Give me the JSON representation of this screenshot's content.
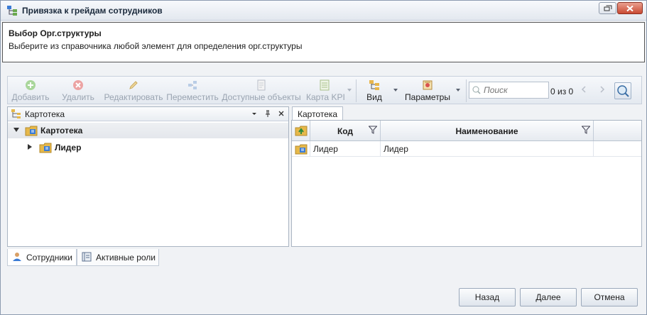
{
  "window": {
    "title": "Привязка к грейдам сотрудников"
  },
  "header": {
    "title": "Выбор Орг.структуры",
    "description": "Выберите из справочника любой элемент для определения орг.структуры"
  },
  "toolbar": {
    "add": "Добавить",
    "delete": "Удалить",
    "edit": "Редактировать",
    "move": "Переместить",
    "available": "Доступные объекты",
    "kpi_map": "Карта KPI",
    "view": "Вид",
    "params": "Параметры",
    "search_placeholder": "Поиск",
    "counter": "0 из 0"
  },
  "left_panel": {
    "title": "Картотека",
    "tree": [
      {
        "label": "Картотека"
      },
      {
        "label": "Лидер"
      }
    ]
  },
  "bottom_tabs": [
    {
      "label": "Сотрудники"
    },
    {
      "label": "Активные роли"
    }
  ],
  "right_panel": {
    "tab": "Картотека",
    "columns": {
      "code": "Код",
      "name": "Наименование"
    },
    "rows": [
      {
        "code": "Лидер",
        "name": "Лидер"
      }
    ]
  },
  "footer": {
    "back": "Назад",
    "next": "Далее",
    "cancel": "Отмена"
  },
  "colors": {
    "accent": "#3a7bd5",
    "folder": "#e6b84a",
    "disabled_text": "#9aa4b1"
  }
}
